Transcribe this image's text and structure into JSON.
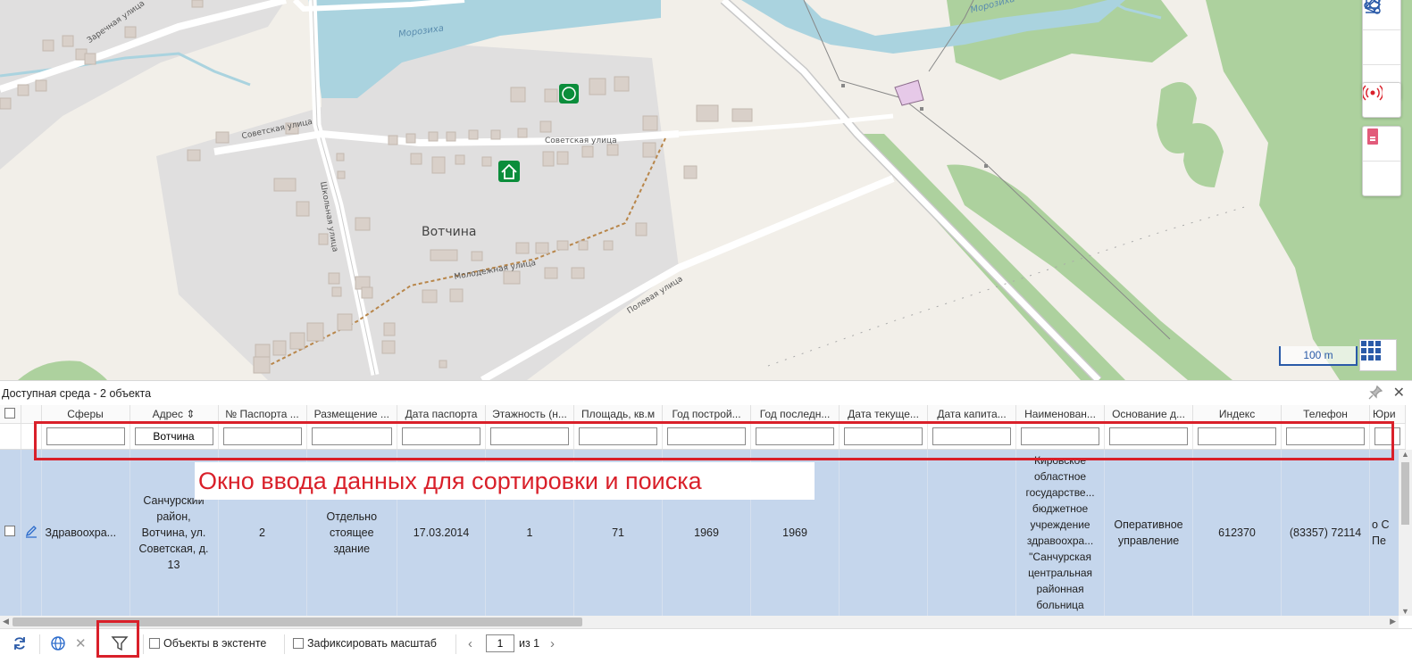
{
  "map": {
    "labels": {
      "village": "Вотчина",
      "river1": "Морозиха",
      "river2": "Морозиха",
      "street_zarechnaya": "Заречная улица",
      "street_sovetskaya1": "Советская улица",
      "street_sovetskaya2": "Советская улица",
      "street_shkolnaya": "Школьная улица",
      "street_molodezhnaya": "Молодежная улица",
      "street_polevaya": "Полевая улица"
    },
    "scale": "100 m",
    "colors": {
      "land": "#f2efe9",
      "water": "#aad3df",
      "forest": "#add19e",
      "residential": "#e0dfdf",
      "building": "#d9d0c9",
      "accent": "#0b8d3b",
      "panel_blue": "#2a5aa8"
    }
  },
  "tools": {
    "icons": [
      "layers-icon",
      "share-icon",
      "eraser-icon",
      "signal-icon",
      "fire-icon",
      "document-icon"
    ]
  },
  "panel": {
    "title": "Доступная среда - 2 объекта"
  },
  "grid": {
    "columns": [
      "Сферы",
      "Адрес",
      "№ Паспорта ...",
      "Размещение ...",
      "Дата паспорта",
      "Этажность (н...",
      "Площадь, кв.м",
      "Год построй...",
      "Год последн...",
      "Дата текуще...",
      "Дата капита...",
      "Наименован...",
      "Основание д...",
      "Индекс",
      "Телефон",
      "Юри"
    ],
    "filter_values": [
      "",
      "Вотчина",
      "",
      "",
      "",
      "",
      "",
      "",
      "",
      "",
      "",
      "",
      "",
      "",
      "",
      ""
    ],
    "row": [
      "Здравоохра...",
      "Санчурский район, Вотчина, ул. Советская, д. 13",
      "2",
      "Отдельно стоящее здание",
      "17.03.2014",
      "1",
      "71",
      "1969",
      "1969",
      "",
      "",
      "Кировское областное государстве... бюджетное учреждение здравоохра... \"Санчурская центральная районная больница",
      "Оперативное управление",
      "612370",
      "(83357) 72114",
      "о С Пе"
    ]
  },
  "annotation": "Окно ввода данных для сортировки и поиска",
  "footer": {
    "extent_label": "Объекты в экстенте",
    "fix_scale_label": "Зафиксировать масштаб",
    "page_value": "1",
    "page_of": "из 1"
  }
}
